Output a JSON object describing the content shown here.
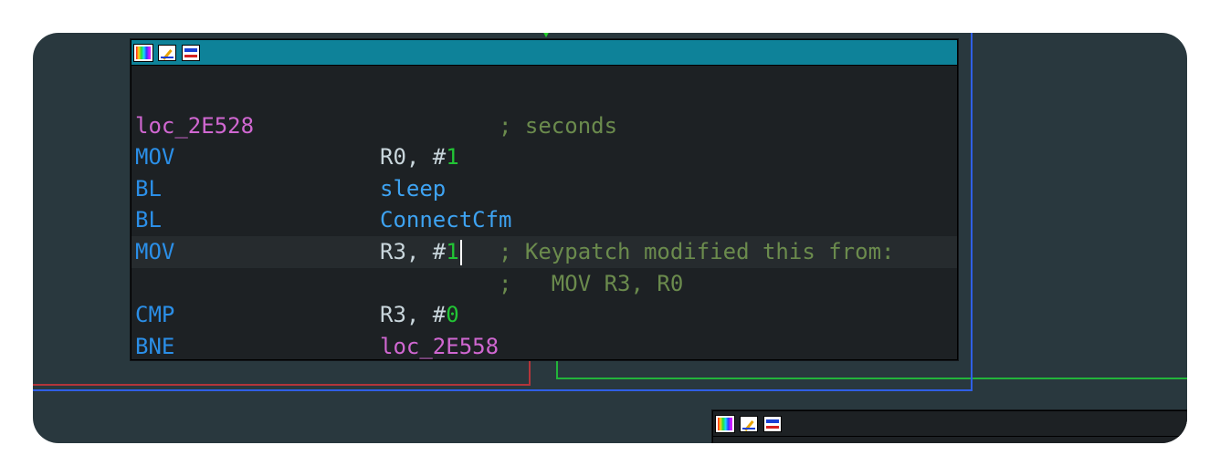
{
  "node_main": {
    "lines": [
      {
        "label": "",
        "mnemonic": "",
        "operand": "",
        "comment": ""
      },
      {
        "label": "loc_2E528",
        "mnemonic": "",
        "operand": "",
        "comment": "; seconds"
      },
      {
        "label": "",
        "mnemonic": "MOV",
        "operand_reg": "R0, #",
        "operand_num": "1",
        "comment": ""
      },
      {
        "label": "",
        "mnemonic": "BL",
        "operand_func": "sleep",
        "comment": ""
      },
      {
        "label": "",
        "mnemonic": "BL",
        "operand_func": "ConnectCfm",
        "comment": ""
      },
      {
        "label": "",
        "mnemonic": "MOV",
        "operand_reg": "R3, #",
        "operand_num": "1",
        "comment": "; Keypatch modified this from:"
      },
      {
        "label": "",
        "mnemonic": "",
        "operand": "",
        "comment": ";   MOV R3, R0"
      },
      {
        "label": "",
        "mnemonic": "CMP",
        "operand_reg": "R3, #",
        "operand_num": "0",
        "comment": ""
      },
      {
        "label": "",
        "mnemonic": "BNE",
        "operand_label": "loc_2E558",
        "comment": ""
      }
    ]
  },
  "icons": [
    "color-palette-icon",
    "edit-pen-icon",
    "graph-view-icon"
  ],
  "colors": {
    "canvas_bg": "#29383e",
    "node_bg": "#1d2124",
    "titlebar": "#0e8299",
    "label": "#d067d1",
    "mnemonic": "#2b8fe8",
    "number": "#22c435",
    "comment": "#6b8b4d",
    "edge_red": "#b3353a",
    "edge_green": "#22b43a",
    "edge_blue": "#2f5fe6"
  }
}
